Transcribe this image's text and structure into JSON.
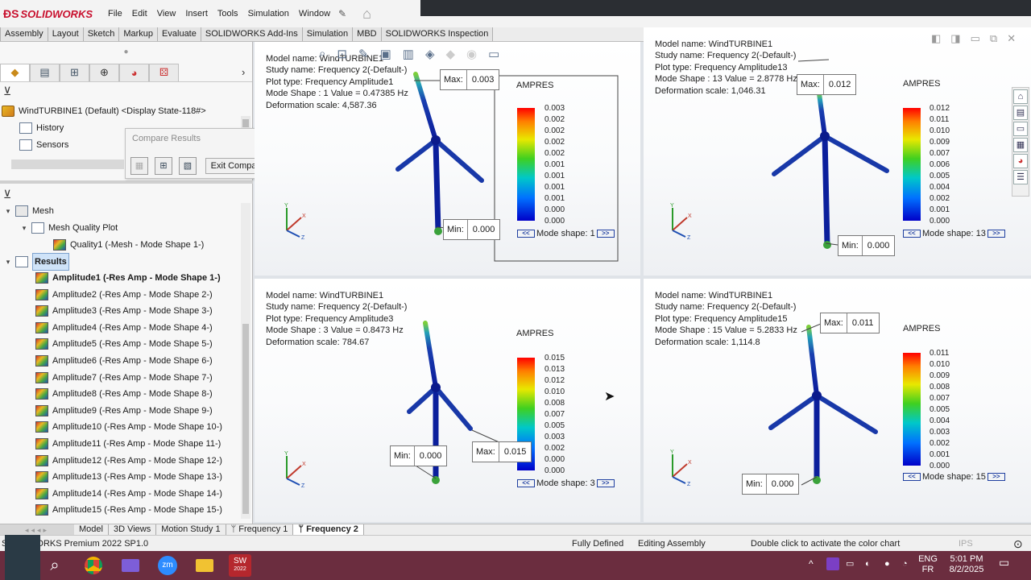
{
  "app": {
    "brand": "SOLIDWORKS",
    "menu": [
      "File",
      "Edit",
      "View",
      "Insert",
      "Tools",
      "Simulation",
      "Window"
    ]
  },
  "command_tabs": [
    "Assembly",
    "Layout",
    "Sketch",
    "Markup",
    "Evaluate",
    "SOLIDWORKS Add-Ins",
    "Simulation",
    "MBD",
    "SOLIDWORKS Inspection"
  ],
  "feature_tree": {
    "root": "WindTURBINE1 (Default) <Display State-118#>",
    "top_items": [
      "History",
      "Sensors"
    ],
    "mesh": "Mesh",
    "mesh_quality_plot": "Mesh Quality Plot",
    "quality_item": "Quality1 (-Mesh - Mode Shape 1-)",
    "results": "Results",
    "amplitudes": [
      "Amplitude1 (-Res Amp - Mode Shape 1-)",
      "Amplitude2 (-Res Amp - Mode Shape 2-)",
      "Amplitude3 (-Res Amp - Mode Shape 3-)",
      "Amplitude4 (-Res Amp - Mode Shape 4-)",
      "Amplitude5 (-Res Amp - Mode Shape 5-)",
      "Amplitude6 (-Res Amp - Mode Shape 6-)",
      "Amplitude7 (-Res Amp - Mode Shape 7-)",
      "Amplitude8 (-Res Amp - Mode Shape 8-)",
      "Amplitude9 (-Res Amp - Mode Shape 9-)",
      "Amplitude10 (-Res Amp - Mode Shape 10-)",
      "Amplitude11 (-Res Amp - Mode Shape 11-)",
      "Amplitude12 (-Res Amp - Mode Shape 12-)",
      "Amplitude13 (-Res Amp - Mode Shape 13-)",
      "Amplitude14 (-Res Amp - Mode Shape 14-)",
      "Amplitude15 (-Res Amp - Mode Shape 15-)"
    ]
  },
  "compare_popup": {
    "title": "Compare Results",
    "exit_label": "Exit Compare"
  },
  "legend_title": "AMPRES",
  "viewports": [
    {
      "model": "Model name: WindTURBINE1",
      "study": "Study name: Frequency 2(-Default-)",
      "plot": "Plot type: Frequency Amplitude1",
      "mode": "Mode Shape : 1  Value =      0.47385 Hz",
      "scale": "Deformation scale: 4,587.36",
      "ticks": [
        "0.003",
        "0.002",
        "0.002",
        "0.002",
        "0.002",
        "0.001",
        "0.001",
        "0.001",
        "0.001",
        "0.000",
        "0.000"
      ],
      "mode_label": "Mode shape: 1",
      "max_label": "Max:",
      "max_value": "0.003",
      "min_label": "Min:",
      "min_value": "0.000"
    },
    {
      "model": "Model name: WindTURBINE1",
      "study": "Study name: Frequency 2(-Default-)",
      "plot": "Plot type: Frequency Amplitude13",
      "mode": "Mode Shape : 13  Value =      2.8778 Hz",
      "scale": "Deformation scale: 1,046.31",
      "ticks": [
        "0.012",
        "0.011",
        "0.010",
        "0.009",
        "0.007",
        "0.006",
        "0.005",
        "0.004",
        "0.002",
        "0.001",
        "0.000"
      ],
      "mode_label": "Mode shape: 13",
      "max_label": "Max:",
      "max_value": "0.012",
      "min_label": "Min:",
      "min_value": "0.000"
    },
    {
      "model": "Model name: WindTURBINE1",
      "study": "Study name: Frequency 2(-Default-)",
      "plot": "Plot type: Frequency Amplitude3",
      "mode": "Mode Shape : 3  Value =      0.8473 Hz",
      "scale": "Deformation scale: 784.67",
      "ticks": [
        "0.015",
        "0.013",
        "0.012",
        "0.010",
        "0.008",
        "0.007",
        "0.005",
        "0.003",
        "0.002",
        "0.000",
        "0.000"
      ],
      "mode_label": "Mode shape: 3",
      "max_label": "Max:",
      "max_value": "0.015",
      "min_label": "Min:",
      "min_value": "0.000"
    },
    {
      "model": "Model name: WindTURBINE1",
      "study": "Study name: Frequency 2(-Default-)",
      "plot": "Plot type: Frequency Amplitude15",
      "mode": "Mode Shape : 15  Value =      5.2833 Hz",
      "scale": "Deformation scale: 1,114.8",
      "ticks": [
        "0.011",
        "0.010",
        "0.009",
        "0.008",
        "0.007",
        "0.005",
        "0.004",
        "0.003",
        "0.002",
        "0.001",
        "0.000"
      ],
      "mode_label": "Mode shape: 15",
      "max_label": "Max:",
      "max_value": "0.011",
      "min_label": "Min:",
      "min_value": "0.000"
    }
  ],
  "bottom_tabs": [
    "Model",
    "3D Views",
    "Motion Study 1",
    "Frequency 1",
    "Frequency 2"
  ],
  "status": {
    "product": "SOLIDWORKS Premium 2022 SP1.0",
    "state": "Fully Defined",
    "mode": "Editing Assembly",
    "hint": "Double click to activate the color chart",
    "units": "IPS"
  },
  "taskbar": {
    "lang1": "ENG",
    "lang2": "FR",
    "time": "5:01 PM",
    "date": "8/2/2025",
    "sw_badge": "2022"
  }
}
